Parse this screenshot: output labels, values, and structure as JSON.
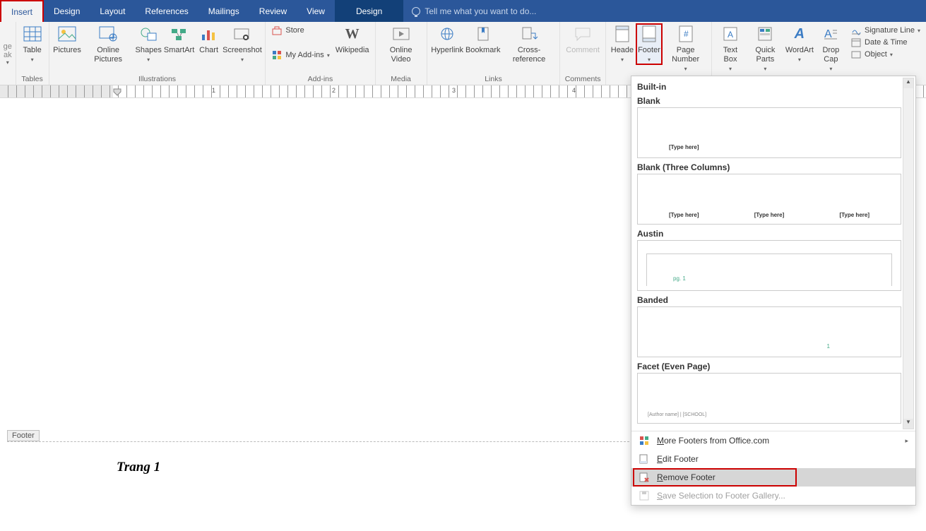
{
  "tabs": {
    "insert": "Insert",
    "design": "Design",
    "layout": "Layout",
    "references": "References",
    "mailings": "Mailings",
    "review": "Review",
    "view": "View",
    "table_design": "Design"
  },
  "tellme_placeholder": "Tell me what you want to do...",
  "ribbon": {
    "left_edge": {
      "line1": "ge",
      "line2": "ak"
    },
    "table": "Table",
    "pictures": "Pictures",
    "online_pictures": "Online Pictures",
    "shapes": "Shapes",
    "smartart": "SmartArt",
    "chart": "Chart",
    "screenshot": "Screenshot",
    "store": "Store",
    "my_addins": "My Add-ins",
    "wikipedia": "Wikipedia",
    "online_video": "Online Video",
    "hyperlink": "Hyperlink",
    "bookmark": "Bookmark",
    "cross_reference": "Cross-reference",
    "comment": "Comment",
    "header": "Heade",
    "footer": "Footer",
    "page_number": "Page Number",
    "text_box": "Text Box",
    "quick_parts": "Quick Parts",
    "wordart": "WordArt",
    "drop_cap": "Drop Cap",
    "signature_line": "Signature Line",
    "date_time": "Date & Time",
    "object": "Object"
  },
  "groups": {
    "tables": "Tables",
    "illustrations": "Illustrations",
    "addins": "Add-ins",
    "media": "Media",
    "links": "Links",
    "comments": "Comments",
    "header_footer": "He"
  },
  "ruler_numbers": [
    "1",
    "2",
    "3",
    "4"
  ],
  "footer_tag": "Footer",
  "footer_text": "Trang 1",
  "gallery": {
    "builtin": "Built-in",
    "blank": "Blank",
    "type_here": "[Type here]",
    "blank_three": "Blank (Three Columns)",
    "austin": "Austin",
    "austin_pg": "pg. 1",
    "banded": "Banded",
    "banded_num": "1",
    "facet": "Facet (Even Page)",
    "facet_txt": "[Author name] | [SCHOOL]",
    "more_footers": "More Footers from Office.com",
    "edit_footer": "Edit Footer",
    "remove_footer": "Remove Footer",
    "save_selection": "Save Selection to Footer Gallery..."
  }
}
